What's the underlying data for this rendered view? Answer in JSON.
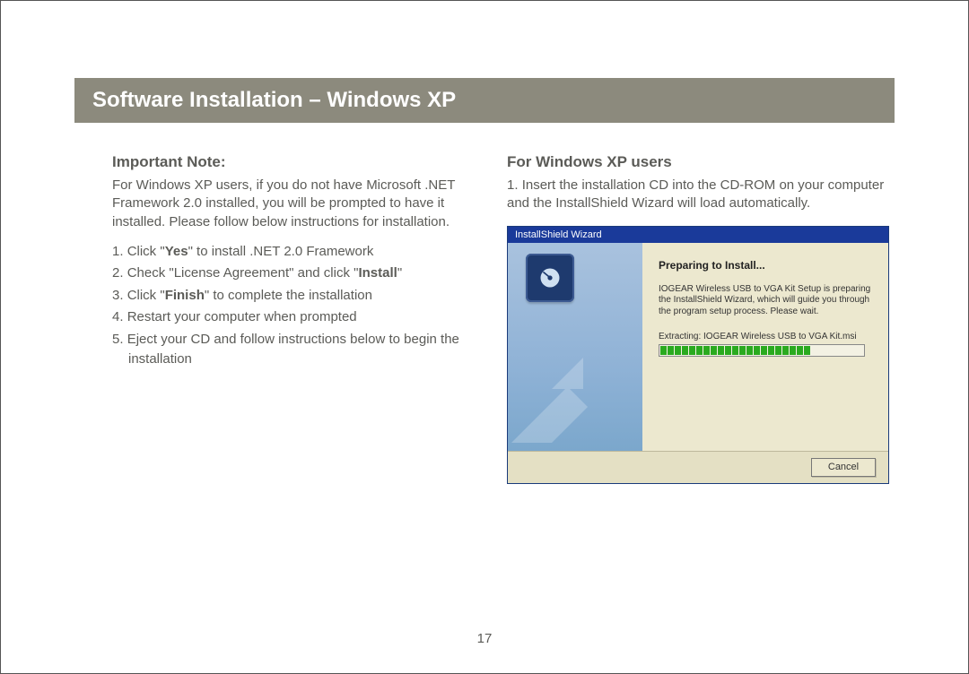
{
  "header": {
    "title": "Software Installation – Windows XP"
  },
  "left": {
    "heading": "Important Note:",
    "intro": "For Windows XP users, if you do not have Microsoft .NET Framework 2.0 installed, you will be prompted to have it installed.  Please follow below instructions for installation.",
    "steps": [
      {
        "num": "1.",
        "pre": "Click \"",
        "bold": "Yes",
        "post": "\" to install .NET 2.0 Framework"
      },
      {
        "num": "2.",
        "pre": "Check \"License Agreement\" and click \"",
        "bold": "Install",
        "post": "\""
      },
      {
        "num": "3.",
        "pre": "Click \"",
        "bold": "Finish",
        "post": "\" to complete the installation"
      },
      {
        "num": "4.",
        "pre": "Restart your computer when prompted",
        "bold": "",
        "post": ""
      },
      {
        "num": "5.",
        "pre": "Eject your CD and follow instructions below to begin the installation",
        "bold": "",
        "post": ""
      }
    ]
  },
  "right": {
    "heading": "For Windows XP users",
    "step1": {
      "num": "1.",
      "text": "Insert the installation CD into the CD-ROM on your computer and the InstallShield Wizard will load automatically."
    }
  },
  "wizard": {
    "titlebar": "InstallShield Wizard",
    "heading": "Preparing to Install...",
    "body": "IOGEAR Wireless USB to VGA Kit Setup is preparing the InstallShield Wizard, which will guide you through the program setup process.  Please wait.",
    "extracting_label": "Extracting: IOGEAR Wireless USB to VGA Kit.msi",
    "cancel": "Cancel",
    "progress_blocks": 21
  },
  "page_number": "17"
}
